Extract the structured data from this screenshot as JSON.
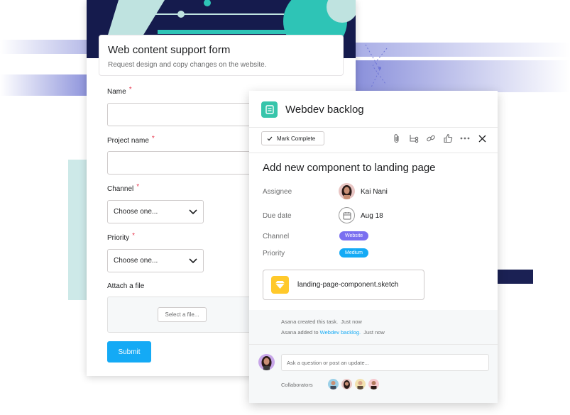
{
  "form": {
    "title": "Web content support form",
    "subtitle": "Request design and copy changes on the website.",
    "fields": {
      "name_label": "Name",
      "project_label": "Project name",
      "channel_label": "Channel",
      "priority_label": "Priority",
      "attach_label": "Attach a file",
      "required_mark": "*"
    },
    "channel_select": "Choose one...",
    "priority_select": "Choose one...",
    "upload_button": "Select a file...",
    "submit_label": "Submit"
  },
  "task": {
    "project_name": "Webdev backlog",
    "mark_complete_label": "Mark Complete",
    "title": "Add new component to landing page",
    "assignee_label": "Assignee",
    "assignee_name": "Kai Nani",
    "due_label": "Due date",
    "due_value": "Aug 18",
    "channel_label": "Channel",
    "channel_value": "Website",
    "priority_label": "Priority",
    "priority_value": "Medium",
    "attachment_name": "landing-page-component.sketch",
    "activity": [
      {
        "actor": "Asana",
        "text": "created this task.",
        "time": "Just now"
      },
      {
        "actor": "Asana",
        "text": "added to",
        "link": "Webdev backlog.",
        "time": "Just now"
      }
    ],
    "comment_placeholder": "Ask a question or post an update...",
    "collaborators_label": "Collaborators"
  },
  "colors": {
    "submit": "#14aaf5",
    "website_pill": "#7a6ff0",
    "medium_pill": "#14aaf5",
    "project_icon": "#37c5ab",
    "required": "#e8384f",
    "sketch_icon": "#ffc92b"
  }
}
